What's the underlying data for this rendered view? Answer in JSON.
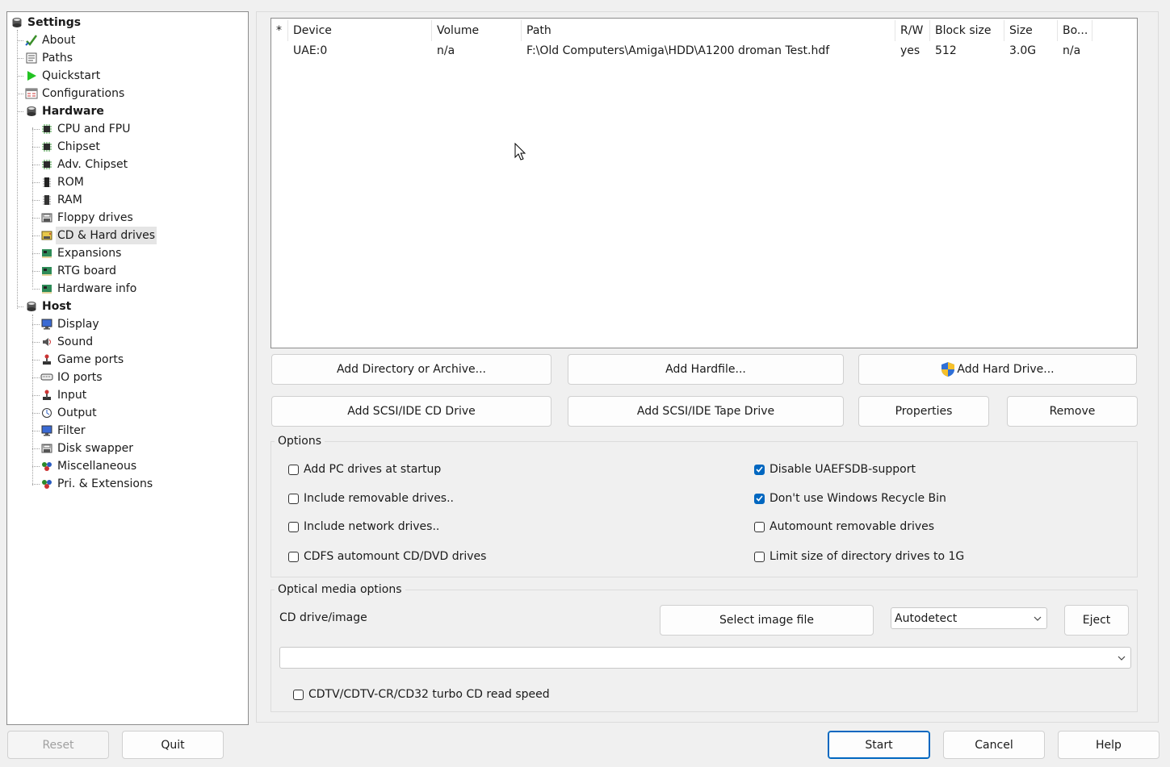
{
  "tree": {
    "root_label": "Settings",
    "items": [
      {
        "label": "About",
        "icon": "checkmark-icon"
      },
      {
        "label": "Paths",
        "icon": "paths-icon"
      },
      {
        "label": "Quickstart",
        "icon": "play-icon"
      },
      {
        "label": "Configurations",
        "icon": "configurations-icon"
      },
      {
        "label": "Hardware",
        "icon": "hardware-icon"
      },
      {
        "label": "CPU and FPU",
        "icon": "chip-icon"
      },
      {
        "label": "Chipset",
        "icon": "chip-icon"
      },
      {
        "label": "Adv. Chipset",
        "icon": "chip-icon"
      },
      {
        "label": "ROM",
        "icon": "rom-icon"
      },
      {
        "label": "RAM",
        "icon": "ram-icon"
      },
      {
        "label": "Floppy drives",
        "icon": "floppy-icon"
      },
      {
        "label": "CD & Hard drives",
        "icon": "hard-drive-icon"
      },
      {
        "label": "Expansions",
        "icon": "expansion-board-icon"
      },
      {
        "label": "RTG board",
        "icon": "expansion-board-icon"
      },
      {
        "label": "Hardware info",
        "icon": "expansion-board-icon"
      },
      {
        "label": "Host",
        "icon": "host-icon"
      },
      {
        "label": "Display",
        "icon": "monitor-icon"
      },
      {
        "label": "Sound",
        "icon": "sound-icon"
      },
      {
        "label": "Game ports",
        "icon": "joystick-icon"
      },
      {
        "label": "IO ports",
        "icon": "io-ports-icon"
      },
      {
        "label": "Input",
        "icon": "joystick-icon"
      },
      {
        "label": "Output",
        "icon": "output-icon"
      },
      {
        "label": "Filter",
        "icon": "monitor-icon"
      },
      {
        "label": "Disk swapper",
        "icon": "floppy-icon"
      },
      {
        "label": "Miscellaneous",
        "icon": "misc-icon"
      },
      {
        "label": "Pri. & Extensions",
        "icon": "misc-icon"
      }
    ]
  },
  "drive_list": {
    "headers": {
      "star": "*",
      "device": "Device",
      "volume": "Volume",
      "path": "Path",
      "rw": "R/W",
      "block_size": "Block size",
      "size": "Size",
      "boot": "Bo..."
    },
    "rows": [
      {
        "device": "UAE:0",
        "volume": "n/a",
        "path": "F:\\Old Computers\\Amiga\\HDD\\A1200 droman Test.hdf",
        "rw": "yes",
        "block_size": "512",
        "size": "3.0G",
        "boot": "n/a"
      }
    ]
  },
  "buttons": {
    "add_directory": "Add Directory or Archive...",
    "add_hardfile": "Add Hardfile...",
    "add_hard_drive": "Add Hard Drive...",
    "add_cd_drive": "Add SCSI/IDE CD Drive",
    "add_tape_drive": "Add SCSI/IDE Tape Drive",
    "properties": "Properties",
    "remove": "Remove"
  },
  "options": {
    "title": "Options",
    "left": [
      {
        "label": "Add PC drives at startup",
        "checked": false
      },
      {
        "label": "Include removable drives..",
        "checked": false
      },
      {
        "label": "Include network drives..",
        "checked": false
      },
      {
        "label": "CDFS automount CD/DVD drives",
        "checked": false
      }
    ],
    "right": [
      {
        "label": "Disable UAEFSDB-support",
        "checked": true
      },
      {
        "label": "Don't use Windows Recycle Bin",
        "checked": true
      },
      {
        "label": "Automount removable drives",
        "checked": false
      },
      {
        "label": "Limit size of directory drives to 1G",
        "checked": false
      }
    ]
  },
  "optical": {
    "title": "Optical media options",
    "cd_label": "CD drive/image",
    "select_image": "Select image file",
    "mode_value": "Autodetect",
    "eject": "Eject",
    "image_path": "",
    "turbo_label": "CDTV/CDTV-CR/CD32 turbo CD read speed",
    "turbo_checked": false
  },
  "footer": {
    "reset": "Reset",
    "quit": "Quit",
    "start": "Start",
    "cancel": "Cancel",
    "help": "Help"
  },
  "colors": {
    "accent": "#0067c0",
    "selection": "#e5e5e5"
  }
}
